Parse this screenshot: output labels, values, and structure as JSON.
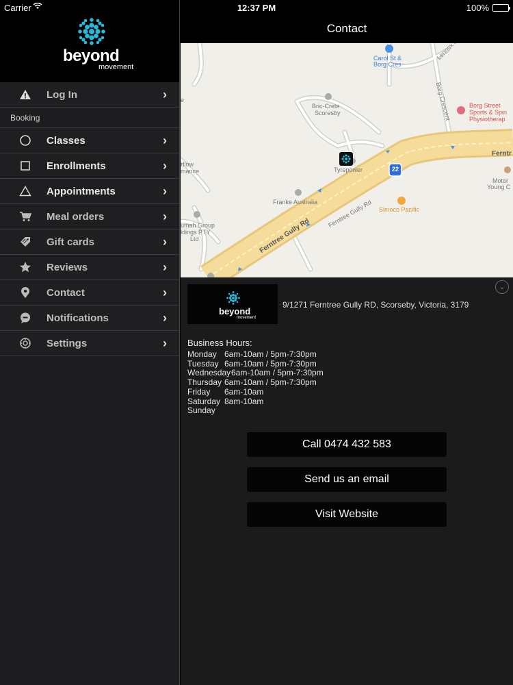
{
  "status_bar": {
    "carrier": "Carrier",
    "time": "12:37 PM",
    "battery": "100%"
  },
  "sidebar": {
    "logo_word": "beyond",
    "logo_sub": "movement",
    "login": {
      "label": "Log In",
      "icon": "warning-icon"
    },
    "section": "Booking",
    "items": [
      {
        "label": "Classes",
        "icon": "circle-icon"
      },
      {
        "label": "Enrollments",
        "icon": "square-icon"
      },
      {
        "label": "Appointments",
        "icon": "triangle-icon"
      },
      {
        "label": "Meal orders",
        "icon": "cart-icon"
      },
      {
        "label": "Gift cards",
        "icon": "tag-icon"
      },
      {
        "label": "Reviews",
        "icon": "star-icon"
      },
      {
        "label": "Contact",
        "icon": "location-pin-icon"
      },
      {
        "label": "Notifications",
        "icon": "chat-bubble-icon"
      },
      {
        "label": "Settings",
        "icon": "gear-icon"
      }
    ]
  },
  "header": {
    "title": "Contact"
  },
  "map": {
    "labels": {
      "carol": "Carol St &",
      "carol2": "Borg Cres",
      "borg_street": "Borg Street",
      "borg_street2": "Sports & Spin",
      "borg_street3": "Physiotherap",
      "bric": "Bric-Crete",
      "bric2": "Scoresby",
      "tyrepower": "Tyrepower",
      "franke": "Franke Australia",
      "simoco": "Simoco Pacific",
      "ferntree_main": "Ferntree Gully Rd",
      "ferntree_side": "Ferntree Gully Rd",
      "ferntree_right": "Ferntr",
      "route": "22",
      "borg_cres": "Borg Crescent",
      "lennox": "Lennox Ct",
      "flow": "rflow",
      "mance": "mance",
      "umah": "umah Group",
      "ldings": "ldings PTY",
      "ltd": "Ltd",
      "motor": "Motor",
      "young": "Young C",
      "e": "e"
    }
  },
  "details": {
    "address": "9/1271 Ferntree Gully RD, Scorseby, Victoria, 3179",
    "hours_title": "Business Hours:",
    "hours": [
      {
        "day": "Monday",
        "time": "6am-10am / 5pm-7:30pm"
      },
      {
        "day": "Tuesday",
        "time": "6am-10am / 5pm-7:30pm"
      },
      {
        "day": "Wednesday",
        "time": "6am-10am / 5pm-7:30pm"
      },
      {
        "day": "Thursday",
        "time": "6am-10am / 5pm-7:30pm"
      },
      {
        "day": "Friday",
        "time": "6am-10am"
      },
      {
        "day": "Saturday",
        "time": "8am-10am"
      },
      {
        "day": "Sunday",
        "time": ""
      }
    ],
    "buttons": {
      "call": "Call 0474 432 583",
      "email": "Send us an email",
      "website": "Visit Website"
    }
  },
  "colors": {
    "accent": "#29b8d8",
    "background": "#1b1b1b",
    "sidebar": "#1d1d1f"
  }
}
